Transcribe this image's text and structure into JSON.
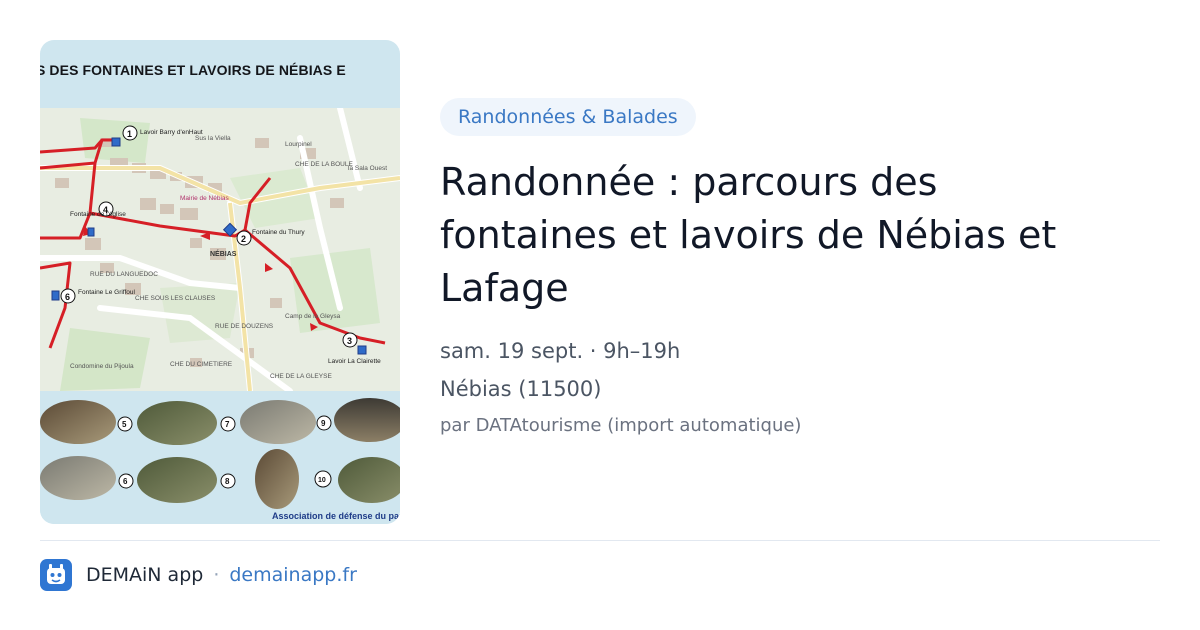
{
  "image": {
    "poster_title": "S DES FONTAINES ET LAVOIRS DE NÉBIAS E",
    "association": "Association de défense du pat",
    "map": {
      "town": "NÉBIAS",
      "stops": [
        {
          "num": "1",
          "label": "Lavoir Barry d'enHaut"
        },
        {
          "num": "2",
          "label": "Fontaine du Thury"
        },
        {
          "num": "3",
          "label": "Lavoir La Clairette"
        },
        {
          "num": "4",
          "label": "Fontaine de l'église"
        },
        {
          "num": "6",
          "label": "Fontaine Le Griffoul"
        }
      ],
      "places": [
        "Sus la Viella",
        "Lourpinel",
        "la Sala Ouest",
        "Camp de la Gleysa",
        "Condomine du Pijoula",
        "Mairie de Nébias"
      ],
      "streets": [
        "CHE SOUS LES CLAUSES",
        "CHE DU CIMETIERE",
        "CHE DE LA GLEYSE",
        "RUE DE DOUZENS",
        "RUE DU LANGUEDOC",
        "CHE DE LA BOULE"
      ]
    },
    "photo_numbers": [
      "5",
      "7",
      "9",
      "6",
      "8",
      "10"
    ]
  },
  "category": "Randonnées & Balades",
  "title": "Randonnée : parcours des fontaines et lavoirs de Nébias et Lafage",
  "date": "sam. 19 sept. · 9h–19h",
  "location": "Nébias (11500)",
  "author": "par DATAtourisme (import automatique)",
  "footer": {
    "app_name": "DEMAiN app",
    "separator": "·",
    "domain": "demainapp.fr"
  },
  "colors": {
    "route": "#d61f26",
    "poster_bg": "#cfe6ef",
    "tag_bg": "#eff5fc",
    "tag_text": "#3a78c4",
    "link": "#3a78c4",
    "logo": "#2f76d2"
  }
}
